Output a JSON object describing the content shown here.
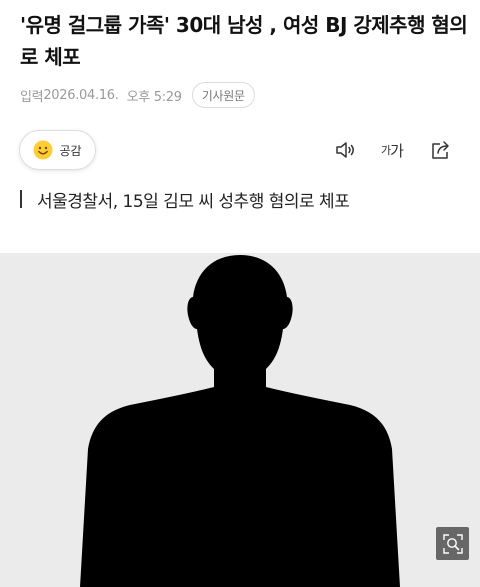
{
  "article": {
    "headline": "'유명 걸그룹 가족' 30대 남성 , 여성 BJ 강제추행 혐의로 체포",
    "meta": {
      "published_label": "입력",
      "date": "2026.04.16.",
      "time": "오후 5:29",
      "original_button": "기사원문"
    },
    "subheading": "서울경찰서, 15일 김모 씨 성추행 혐의로 체포"
  },
  "toolbar": {
    "like_label": "공감",
    "like_icon": "smile-emoji-icon",
    "speaker_icon": "speaker-icon",
    "font_size_small": "가",
    "font_size_large": "가",
    "share_icon": "share-icon"
  },
  "photo": {
    "icon": "zoom-image-icon",
    "colors": {
      "background": "#ebebeb",
      "silhouette": "#000000"
    }
  }
}
